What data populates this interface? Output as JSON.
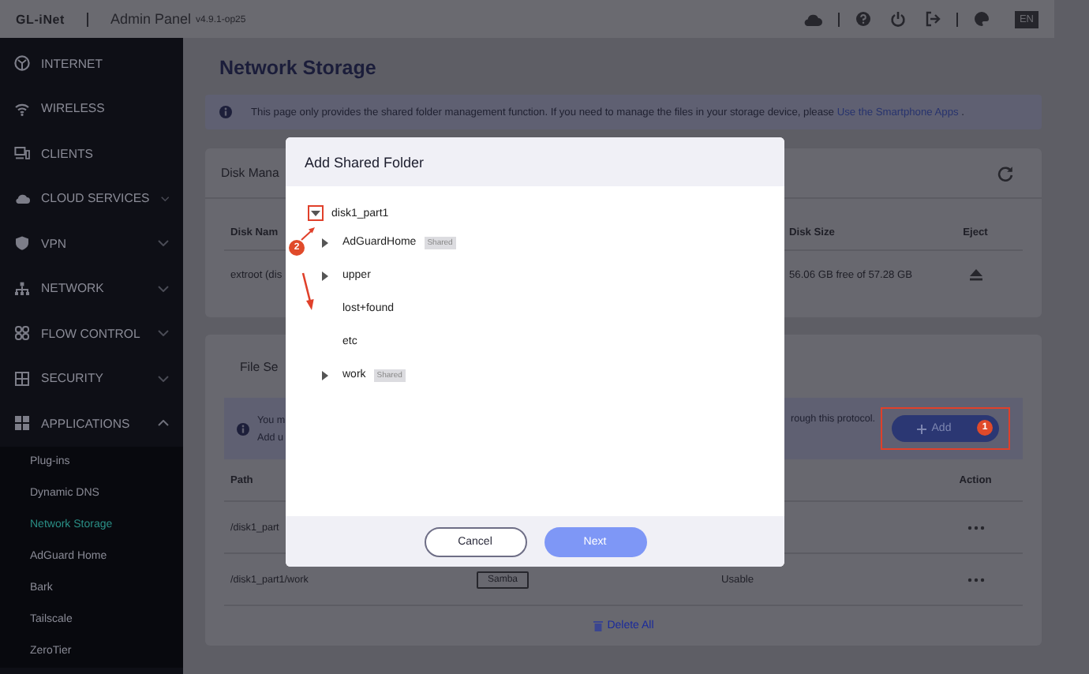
{
  "header": {
    "logo": "GL-iNet",
    "title": "Admin Panel",
    "version": "v4.9.1-op25",
    "language": "EN"
  },
  "sidebar": {
    "items": [
      {
        "label": "INTERNET",
        "kind": "link",
        "selected": false
      },
      {
        "label": "WIRELESS",
        "kind": "link",
        "selected": false
      },
      {
        "label": "CLIENTS",
        "kind": "link",
        "selected": false
      },
      {
        "label": "CLOUD SERVICES",
        "kind": "group",
        "expanded": false,
        "selected": false
      },
      {
        "label": "VPN",
        "kind": "group",
        "expanded": false,
        "selected": false
      },
      {
        "label": "NETWORK",
        "kind": "group",
        "expanded": false,
        "selected": false
      },
      {
        "label": "FLOW CONTROL",
        "kind": "group",
        "expanded": false,
        "selected": false
      },
      {
        "label": "SECURITY",
        "kind": "group",
        "expanded": false,
        "selected": false
      },
      {
        "label": "APPLICATIONS",
        "kind": "group",
        "expanded": true,
        "selected": false,
        "children": [
          {
            "label": "Plug-ins",
            "selected": false
          },
          {
            "label": "Dynamic DNS",
            "selected": false
          },
          {
            "label": "Network Storage",
            "selected": true
          },
          {
            "label": "AdGuard Home",
            "selected": false
          },
          {
            "label": "Bark",
            "selected": false
          },
          {
            "label": "Tailscale",
            "selected": false
          },
          {
            "label": "ZeroTier",
            "selected": false
          }
        ]
      }
    ]
  },
  "page": {
    "title": "Network Storage",
    "notice": "This page only provides the shared folder management function. If you need to manage the files in your storage device, please",
    "notice_link": "Use the Smartphone Apps",
    "notice_end": "."
  },
  "disk_card": {
    "title": "Disk Mana",
    "columns": [
      "Disk Nam",
      "Disk Size",
      "Eject"
    ],
    "rows": [
      {
        "name": "extroot (dis",
        "size": "56.06 GB free of 57.28 GB"
      }
    ]
  },
  "file_card": {
    "title": "File Se",
    "info_lines": [
      "You m",
      "Add u"
    ],
    "info_tail": "rough this protocol.",
    "add_button": "Add",
    "columns": [
      "Path",
      "Action"
    ],
    "rows": [
      {
        "path": "/disk1_part"
      },
      {
        "path": "/disk1_part1/work",
        "protocol": "Samba",
        "status": "Usable"
      }
    ],
    "delete_all": "Delete All"
  },
  "dialog": {
    "title": "Add Shared Folder",
    "tree": [
      {
        "label": "disk1_part1",
        "kind": "folder",
        "expanded": true,
        "children": [
          {
            "label": "AdGuardHome",
            "kind": "folder",
            "expanded": false,
            "badge": "Shared"
          },
          {
            "label": "upper",
            "kind": "folder",
            "expanded": false
          },
          {
            "label": "lost+found",
            "kind": "leaf"
          },
          {
            "label": "etc",
            "kind": "leaf"
          },
          {
            "label": "work",
            "kind": "folder",
            "expanded": false,
            "badge": "Shared"
          }
        ]
      }
    ],
    "buttons": [
      {
        "label": "Cancel",
        "kind": "secondary"
      },
      {
        "label": "Next",
        "kind": "primary"
      }
    ]
  },
  "annotations": [
    {
      "label": "1"
    },
    {
      "label": "2"
    }
  ]
}
